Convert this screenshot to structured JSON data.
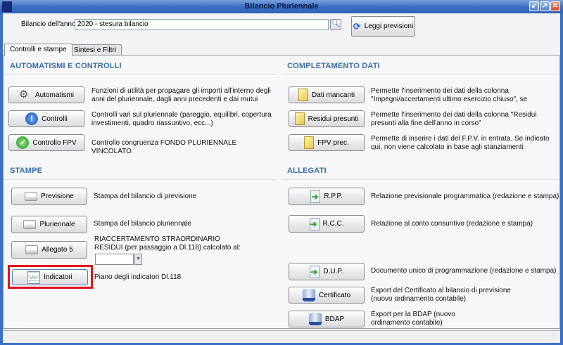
{
  "window": {
    "title": "Bilancio Pluriennale",
    "buttons": [
      "minimize",
      "maximize",
      "close"
    ]
  },
  "header": {
    "year_label": "Bilancio dell'anno:",
    "year_value": "2020 - stesura bilancio",
    "leggi_label": "Leggi previsioni"
  },
  "tabs": [
    {
      "label": "Controlli e stampe",
      "active": true
    },
    {
      "label": "Sintesi e Filtri",
      "active": false
    }
  ],
  "automatismi": {
    "title": "AUTOMATISMI E CONTROLLI",
    "items": [
      {
        "label": "Automatismi",
        "icon": "tools-icon",
        "desc": "Funzioni di utilità per propagare gli importi all'interno degli anni del pluriennale, dagli anni precedenti e dai mutui"
      },
      {
        "label": "Controlli",
        "icon": "info-exclamation-icon",
        "desc": "Controlli vari sul pluriennale (pareggio, equilibri, copertura investimenti, quadro riassuntivo, ecc...)"
      },
      {
        "label": "Controllo FPV",
        "icon": "checkmark-icon",
        "desc": "Controllo congruenza FONDO PLURIENNALE VINCOLATO"
      }
    ]
  },
  "completamento": {
    "title": "COMPLETAMENTO DATI",
    "items": [
      {
        "label": "Dati mancanti",
        "icon": "edit-document-icon",
        "desc": "Permette l'inserimento dei dati della colonna \"Impegni/accertamenti ultimo esercizio chiuso\", se"
      },
      {
        "label": "Residui presunti",
        "icon": "edit-document-icon",
        "desc": "Permette l'inserimento dei dati della colonna \"Residui presunti alla fine dell'anno in corso\""
      },
      {
        "label": "FPV prec.",
        "icon": "edit-document-icon",
        "desc": "Permette di inserire i dati del F.P.V. in entrata. Se indicato qui, non viene calcolato in base agli stanziamenti"
      }
    ]
  },
  "stampe": {
    "title": "STAMPE",
    "items": [
      {
        "label": "Previsione",
        "icon": "printer-icon",
        "desc": "Stampa del bilancio di previsione"
      },
      {
        "label": "Pluriennale",
        "icon": "printer-icon",
        "desc": "Stampa del bilancio pluriennale"
      },
      {
        "label": "Allegato 5",
        "icon": "printer-icon",
        "desc": "RIACCERTAMENTO STRAORDINARIO RESIDUI (per passaggio a Dl.118) calcolato al:",
        "date_value": ""
      },
      {
        "label": "Indicatori",
        "icon": "chart-icon",
        "desc": "Piano degli indicatori Dl.118",
        "highlighted": true
      }
    ]
  },
  "allegati": {
    "title": "ALLEGATI",
    "items": [
      {
        "label": "R.P.P.",
        "icon": "document-arrow-icon",
        "desc": "Relazione previsionale programmatica (redazione e stampa)"
      },
      {
        "label": "R.C.C.",
        "icon": "document-arrow-icon",
        "desc": "Relazione al conto consuntivo (redazione e stampa)"
      },
      {
        "label": "D.U.P.",
        "icon": "document-arrow-icon",
        "desc": "Documento unico di programmazione (redazione e stampa)"
      },
      {
        "label": "Certificato",
        "icon": "database-save-icon",
        "desc": "Export del Certificato al bilancio di previsione (nuovo ordinamento contabile)"
      },
      {
        "label": "BDAP",
        "icon": "database-save-icon",
        "desc": "Export per la BDAP (nuovo ordinamento contabile)"
      }
    ]
  },
  "colors": {
    "titlebar": "#3a6fc4",
    "section": "#3a6ea8",
    "highlight": "#e0141e"
  }
}
